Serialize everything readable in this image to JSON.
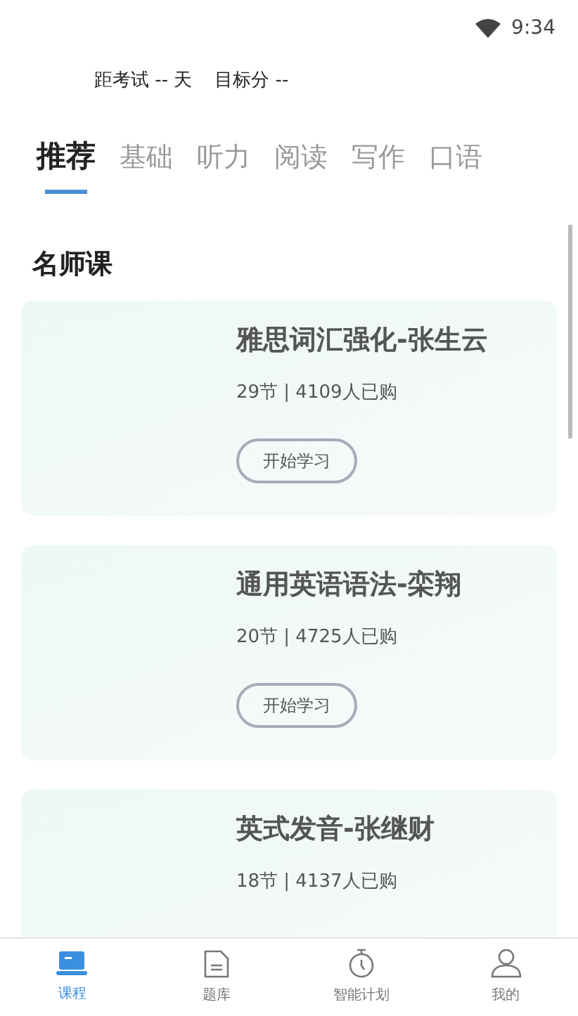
{
  "status_bar": {
    "time": "9:34"
  },
  "exam_info": {
    "days": "距考试 -- 天",
    "target": "目标分 --"
  },
  "tabs": [
    {
      "label": "推荐",
      "selected": true
    },
    {
      "label": "基础",
      "selected": false
    },
    {
      "label": "听力",
      "selected": false
    },
    {
      "label": "阅读",
      "selected": false
    },
    {
      "label": "写作",
      "selected": false
    },
    {
      "label": "口语",
      "selected": false
    }
  ],
  "section_title": "名师课",
  "courses": [
    {
      "title": "雅思词汇强化-张生云",
      "meta": "29节 | 4109人已购",
      "button": "开始学习"
    },
    {
      "title": "通用英语语法-栾翔",
      "meta": "20节 | 4725人已购",
      "button": "开始学习"
    },
    {
      "title": "英式发音-张继财",
      "meta": "18节 | 4137人已购"
    }
  ],
  "bottom_nav": [
    {
      "label": "课程",
      "kind": "laptop",
      "selected": true
    },
    {
      "label": "题库",
      "kind": "document",
      "selected": false
    },
    {
      "label": "智能计划",
      "kind": "timer",
      "selected": false
    },
    {
      "label": "我的",
      "kind": "person",
      "selected": false
    }
  ]
}
